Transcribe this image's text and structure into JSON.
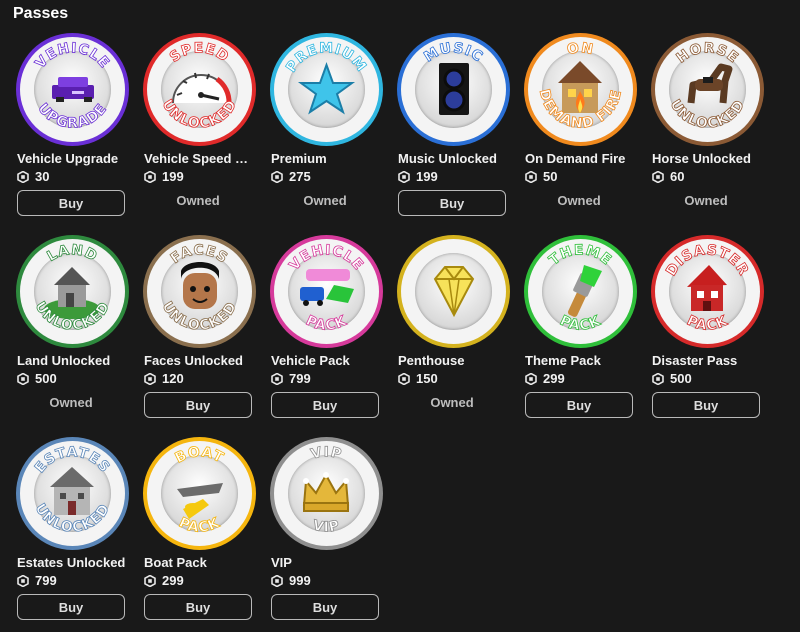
{
  "section_title": "Passes",
  "buy_label": "Buy",
  "owned_label": "Owned",
  "passes": [
    {
      "name": "Vehicle Upgrade",
      "price": "30",
      "status": "buy",
      "top_text": "VEHICLE",
      "bottom_text": "UPGRADE",
      "ring_color": "#6a2fd6",
      "icon": "car-icon"
    },
    {
      "name": "Vehicle Speed Upgrade",
      "display_name": "Vehicle Speed U...",
      "price": "199",
      "status": "owned",
      "top_text": "SPEED",
      "bottom_text": "UNLOCKED",
      "ring_color": "#e02a2a",
      "icon": "speedometer-icon"
    },
    {
      "name": "Premium",
      "price": "275",
      "status": "owned",
      "top_text": "PREMIUM",
      "bottom_text": "",
      "ring_color": "#2fb6e0",
      "icon": "star-icon"
    },
    {
      "name": "Music Unlocked",
      "price": "199",
      "status": "buy",
      "top_text": "MUSIC",
      "bottom_text": "",
      "ring_color": "#2a6fd6",
      "icon": "speaker-icon"
    },
    {
      "name": "On Demand Fire",
      "price": "50",
      "status": "owned",
      "top_text": "ON",
      "bottom_text": "DEMAND FIRE",
      "ring_color": "#f08a1e",
      "icon": "burning-house-icon"
    },
    {
      "name": "Horse Unlocked",
      "price": "60",
      "status": "owned",
      "top_text": "HORSE",
      "bottom_text": "UNLOCKED",
      "ring_color": "#8b5a35",
      "icon": "horse-icon"
    },
    {
      "name": "Land Unlocked",
      "price": "500",
      "status": "owned",
      "top_text": "LAND",
      "bottom_text": "UNLOCKED",
      "ring_color": "#2e8a3e",
      "icon": "house-on-land-icon"
    },
    {
      "name": "Faces Unlocked",
      "price": "120",
      "status": "buy",
      "top_text": "FACES",
      "bottom_text": "UNLOCKED",
      "ring_color": "#8a6f4e",
      "icon": "face-icon"
    },
    {
      "name": "Vehicle Pack",
      "price": "799",
      "status": "buy",
      "top_text": "VEHICLE",
      "bottom_text": "PACK",
      "ring_color": "#d63a9b",
      "icon": "vehicles-icon"
    },
    {
      "name": "Penthouse",
      "price": "150",
      "status": "owned",
      "top_text": "",
      "bottom_text": "",
      "ring_color": "#d4b21e",
      "icon": "diamond-icon"
    },
    {
      "name": "Theme Pack",
      "price": "299",
      "status": "buy",
      "top_text": "THEME",
      "bottom_text": "PACK",
      "ring_color": "#2fbf3a",
      "icon": "paintbrush-icon"
    },
    {
      "name": "Disaster Pass",
      "price": "500",
      "status": "buy",
      "top_text": "DISASTER",
      "bottom_text": "PACK",
      "ring_color": "#d62a2a",
      "icon": "broken-house-icon"
    },
    {
      "name": "Estates Unlocked",
      "price": "799",
      "status": "buy",
      "top_text": "ESTATES",
      "bottom_text": "UNLOCKED",
      "ring_color": "#5a86b8",
      "icon": "estate-house-icon"
    },
    {
      "name": "Boat Pack",
      "price": "299",
      "status": "buy",
      "top_text": "BOAT",
      "bottom_text": "PACK",
      "ring_color": "#f5b50e",
      "icon": "boat-icon"
    },
    {
      "name": "VIP",
      "price": "999",
      "status": "buy",
      "top_text": "VIP",
      "bottom_text": "VIP",
      "ring_color": "#8f8f8f",
      "icon": "crown-icon"
    }
  ]
}
